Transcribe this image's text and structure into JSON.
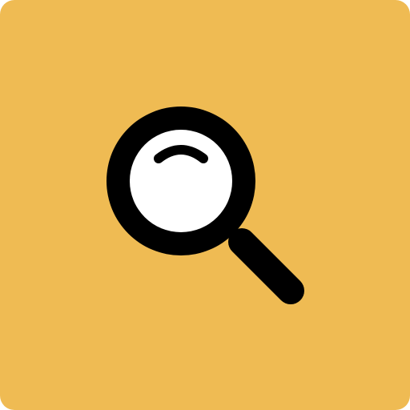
{
  "icon": {
    "name": "search-icon",
    "background_color": "#EFBB53",
    "stroke_color": "#000000",
    "lens_color": "#FFFFFF"
  }
}
